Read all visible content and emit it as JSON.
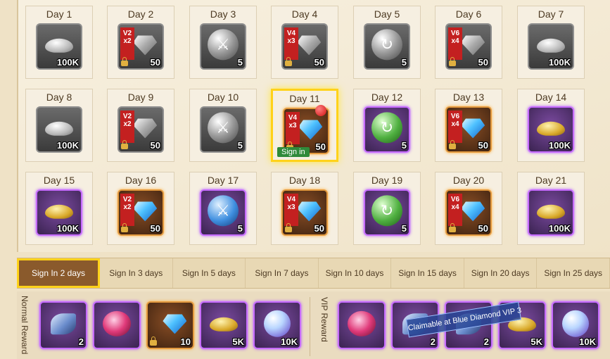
{
  "days": [
    {
      "label": "Day 1",
      "item": "silver-ingot",
      "qty": "100K",
      "frame": "gray"
    },
    {
      "label": "Day 2",
      "item": "silver-gem",
      "ribbon": [
        "V2",
        "x2"
      ],
      "qty": "50",
      "frame": "gray",
      "locked": true
    },
    {
      "label": "Day 3",
      "item": "gray-sword-orb",
      "qty": "5",
      "frame": "gray"
    },
    {
      "label": "Day 4",
      "item": "silver-gem",
      "ribbon": [
        "V4",
        "x3"
      ],
      "qty": "50",
      "frame": "gray",
      "locked": true
    },
    {
      "label": "Day 5",
      "item": "gray-swirl-orb",
      "qty": "5",
      "frame": "gray"
    },
    {
      "label": "Day 6",
      "item": "silver-gem",
      "ribbon": [
        "V6",
        "x4"
      ],
      "qty": "50",
      "frame": "gray",
      "locked": true
    },
    {
      "label": "Day 7",
      "item": "silver-ingot",
      "qty": "100K",
      "frame": "gray"
    },
    {
      "label": "Day 8",
      "item": "silver-ingot",
      "qty": "100K",
      "frame": "gray"
    },
    {
      "label": "Day 9",
      "item": "silver-gem",
      "ribbon": [
        "V2",
        "x2"
      ],
      "qty": "50",
      "frame": "gray",
      "locked": true
    },
    {
      "label": "Day 10",
      "item": "gray-sword-orb",
      "qty": "5",
      "frame": "gray"
    },
    {
      "label": "Day 11",
      "item": "blue-diamond",
      "ribbon": [
        "V4",
        "x3"
      ],
      "qty": "50",
      "frame": "orange",
      "locked": true,
      "active": true,
      "action": "Sign in"
    },
    {
      "label": "Day 12",
      "item": "green-swirl-orb",
      "qty": "5",
      "frame": "purple"
    },
    {
      "label": "Day 13",
      "item": "blue-diamond",
      "ribbon": [
        "V6",
        "x4"
      ],
      "qty": "50",
      "frame": "orange",
      "locked": true
    },
    {
      "label": "Day 14",
      "item": "gold-ingot",
      "qty": "100K",
      "frame": "purple"
    },
    {
      "label": "Day 15",
      "item": "gold-ingot",
      "qty": "100K",
      "frame": "purple"
    },
    {
      "label": "Day 16",
      "item": "blue-diamond",
      "ribbon": [
        "V2",
        "x2"
      ],
      "qty": "50",
      "frame": "orange",
      "locked": true
    },
    {
      "label": "Day 17",
      "item": "blue-sword-orb",
      "qty": "5",
      "frame": "purple"
    },
    {
      "label": "Day 18",
      "item": "blue-diamond",
      "ribbon": [
        "V4",
        "x3"
      ],
      "qty": "50",
      "frame": "orange",
      "locked": true
    },
    {
      "label": "Day 19",
      "item": "green-swirl-orb",
      "qty": "5",
      "frame": "purple"
    },
    {
      "label": "Day 20",
      "item": "blue-diamond",
      "ribbon": [
        "V6",
        "x4"
      ],
      "qty": "50",
      "frame": "orange",
      "locked": true
    },
    {
      "label": "Day 21",
      "item": "gold-ingot",
      "qty": "100K",
      "frame": "purple"
    }
  ],
  "tabs": [
    "Sign In 2 days",
    "Sign In 3 days",
    "Sign In 5 days",
    "Sign In 7 days",
    "Sign In 10 days",
    "Sign In 15 days",
    "Sign In 20 days",
    "Sign In 25 days"
  ],
  "selected_tab": 0,
  "normal_reward": {
    "label": "Normal Reward",
    "items": [
      {
        "item": "blue-feather",
        "qty": "2",
        "frame": "purple"
      },
      {
        "item": "pink-lamp",
        "qty": "",
        "frame": "purple"
      },
      {
        "item": "blue-diamond",
        "qty": "10",
        "frame": "orange",
        "locked": true
      },
      {
        "item": "gold-ingot",
        "qty": "5K",
        "frame": "purple"
      },
      {
        "item": "blue-pearl",
        "qty": "10K",
        "frame": "purple"
      }
    ]
  },
  "vip_reward": {
    "label": "VIP Reward",
    "items": [
      {
        "item": "pink-lamp",
        "qty": "",
        "frame": "purple"
      },
      {
        "item": "blue-feather",
        "qty": "2",
        "frame": "purple"
      },
      {
        "item": "blue-feather",
        "qty": "2",
        "frame": "purple"
      },
      {
        "item": "gold-ingot",
        "qty": "5K",
        "frame": "purple"
      },
      {
        "item": "blue-pearl",
        "qty": "10K",
        "frame": "purple"
      }
    ],
    "banner": "Claimable at Blue Diamond VIP 3"
  },
  "colors": {
    "highlight": "#ffd21a",
    "selected_tab_bg": "#8a5a2c",
    "purple_frame": "#c76cff",
    "orange_frame": "#e39a3f"
  }
}
